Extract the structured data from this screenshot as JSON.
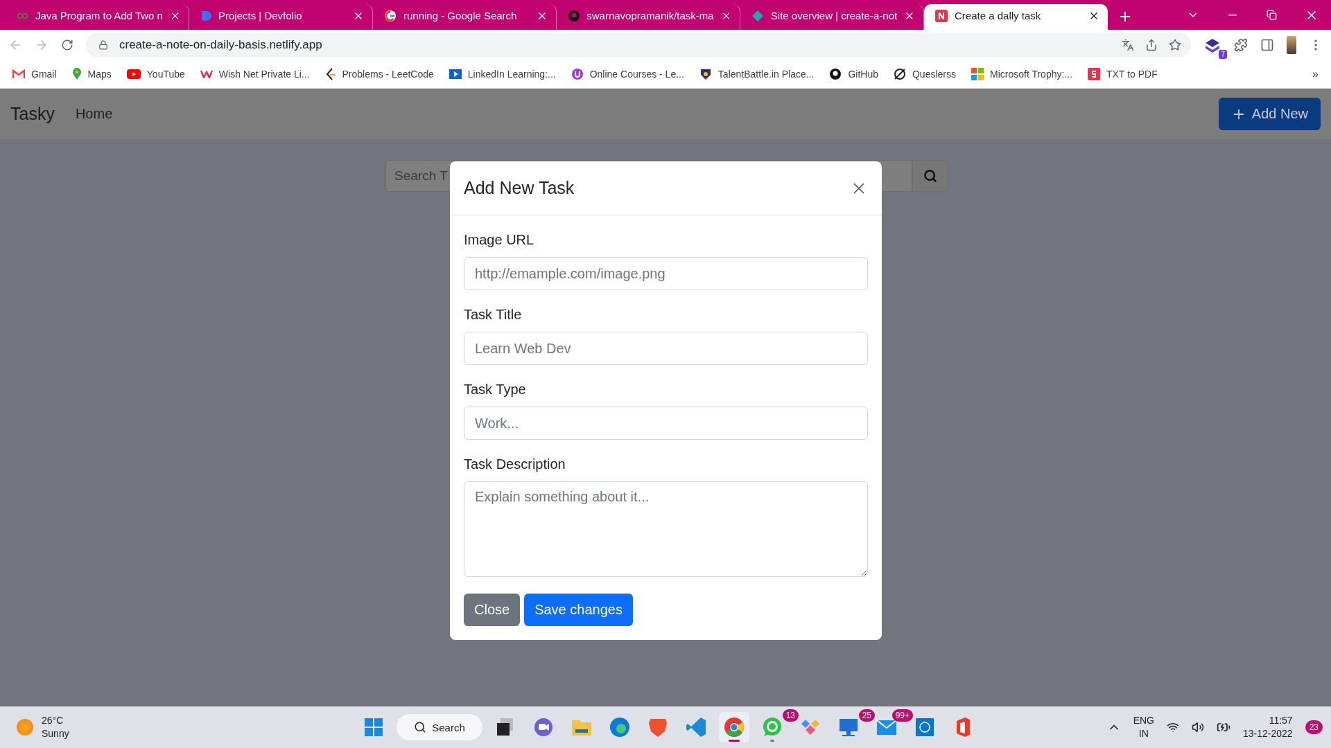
{
  "browser": {
    "tabs": [
      {
        "title": "Java Program to Add Two n",
        "selected": false
      },
      {
        "title": "Projects | Devfolio",
        "selected": false
      },
      {
        "title": "running - Google Search",
        "selected": false
      },
      {
        "title": "swarnavopramanik/task-ma",
        "selected": false
      },
      {
        "title": "Site overview | create-a-not",
        "selected": false
      },
      {
        "title": "Create a dally task",
        "selected": true
      }
    ],
    "address": "create-a-note-on-daily-basis.netlify.app",
    "extension_badge": "7",
    "bookmarks": [
      "Gmail",
      "Maps",
      "YouTube",
      "Wish Net Private Li...",
      "Problems - LeetCode",
      "LinkedIn Learning:...",
      "Online Courses - Le...",
      "TalentBattle.in Place...",
      "GitHub",
      "Queslerss",
      "Microsoft Trophy:...",
      "TXT to PDF"
    ],
    "bookmarks_more": "»"
  },
  "navbar": {
    "brand": "Tasky",
    "links": [
      "Home"
    ],
    "button": "Add New"
  },
  "search": {
    "placeholder": "Search T"
  },
  "modal": {
    "title": "Add New Task",
    "fields": [
      {
        "label": "Image URL",
        "placeholder": "http://emample.com/image.png",
        "kind": "input"
      },
      {
        "label": "Task Title",
        "placeholder": "Learn Web Dev",
        "kind": "input"
      },
      {
        "label": "Task Type",
        "placeholder": "Work...",
        "kind": "input"
      },
      {
        "label": "Task Description",
        "placeholder": "Explain something about it...",
        "kind": "textarea"
      }
    ],
    "buttons": [
      {
        "label": "Close",
        "kind": "secondary"
      },
      {
        "label": "Save changes",
        "kind": "primary"
      }
    ]
  },
  "taskbar": {
    "weather": {
      "temperature": "26°C",
      "condition": "Sunny"
    },
    "search": "Search",
    "apps": [
      {
        "running": false,
        "focused": false
      },
      {
        "running": false,
        "focused": false
      },
      {
        "running": false,
        "focused": false
      },
      {
        "running": false,
        "focused": false
      },
      {
        "running": false,
        "focused": false
      },
      {
        "running": false,
        "focused": false
      },
      {
        "running": true,
        "focused": true
      },
      {
        "badge": "13",
        "running": true,
        "focused": false
      },
      {
        "running": false,
        "focused": false
      },
      {
        "badge": "25",
        "running": false,
        "focused": false
      },
      {
        "badge": "99+",
        "running": false,
        "focused": false
      },
      {
        "running": false,
        "focused": false
      },
      {
        "running": false,
        "focused": false
      }
    ],
    "language": "ENG",
    "region": "IN",
    "time": "11:57",
    "date": "13-12-2022",
    "notifications": "23"
  }
}
